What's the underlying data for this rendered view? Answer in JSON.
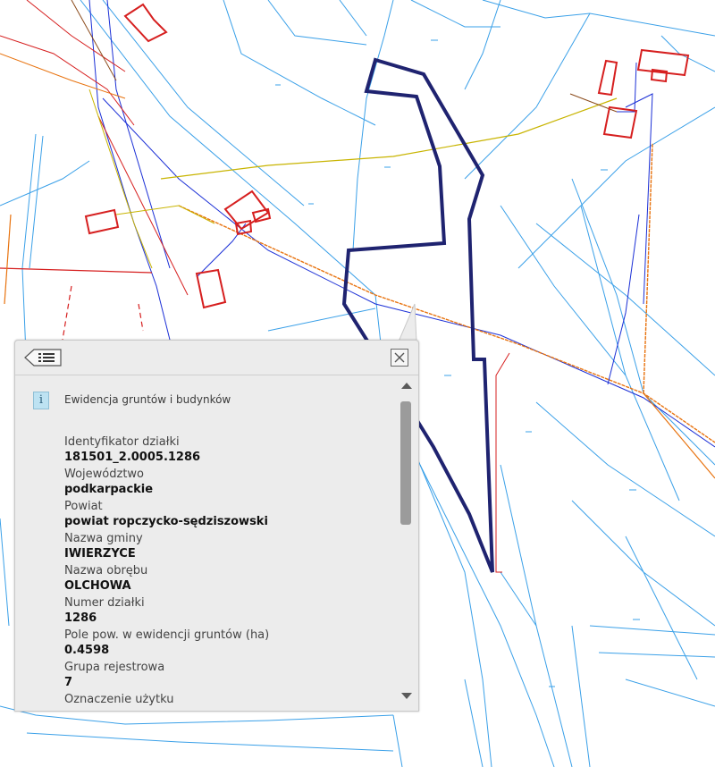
{
  "popup": {
    "section_title": "Ewidencja gruntów i budynków",
    "info_icon": "info-icon",
    "fields": [
      {
        "label": "Identyfikator działki",
        "value": "181501_2.0005.1286"
      },
      {
        "label": "Województwo",
        "value": "podkarpackie"
      },
      {
        "label": "Powiat",
        "value": "powiat ropczycko-sędziszowski"
      },
      {
        "label": "Nazwa gminy",
        "value": "IWIERZYCE"
      },
      {
        "label": "Nazwa obrębu",
        "value": "OLCHOWA"
      },
      {
        "label": "Numer działki",
        "value": "1286"
      },
      {
        "label": "Pole pow. w ewidencji gruntów (ha)",
        "value": "0.4598"
      },
      {
        "label": "Grupa rejestrowa",
        "value": "7"
      },
      {
        "label": "Oznaczenie użytku",
        "value": ""
      }
    ]
  },
  "colors": {
    "parcel_lines": "#3aa0e8",
    "selected_parcel": "#1f2370",
    "buildings": "#d61f1f",
    "road_power": "#e8730f",
    "utility_yellow": "#c8b400",
    "utility_blue": "#1b2fd6",
    "utility_brown": "#8a4a1a"
  }
}
